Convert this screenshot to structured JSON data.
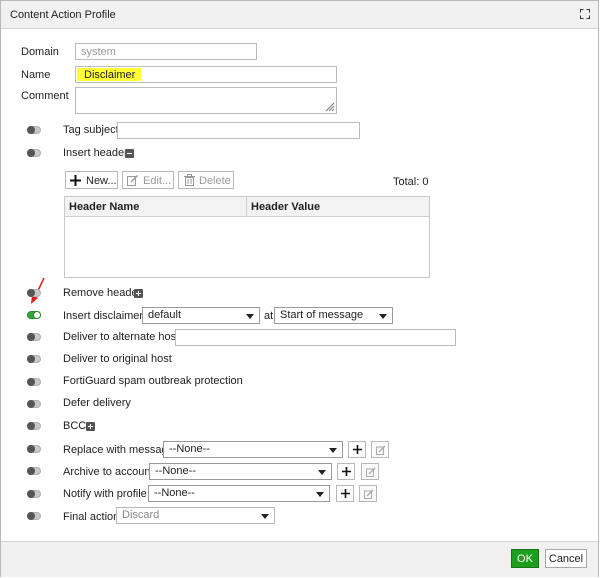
{
  "dialog": {
    "title": "Content Action Profile",
    "maximize_icon": "maximize-icon"
  },
  "form": {
    "domain_label": "Domain",
    "domain_value": "system",
    "name_label": "Name",
    "name_value": "Disclaimer",
    "comment_label": "Comment",
    "comment_value": ""
  },
  "options": {
    "tag_subject": {
      "label": "Tag subject",
      "enabled": false,
      "value": ""
    },
    "insert_header": {
      "label": "Insert header",
      "enabled": false,
      "icon": "collapse-icon"
    },
    "remove_header": {
      "label": "Remove header",
      "enabled": false,
      "icon": "expand-icon"
    },
    "insert_disclaimer": {
      "label": "Insert disclaimer",
      "enabled": true,
      "select_value": "default",
      "at_label": "at",
      "position_value": "Start of message"
    },
    "deliver_alternate_host": {
      "label": "Deliver to alternate host",
      "enabled": false,
      "value": ""
    },
    "deliver_original_host": {
      "label": "Deliver to original host",
      "enabled": false
    },
    "fortiguard_outbreak": {
      "label": "FortiGuard spam outbreak protection",
      "enabled": false
    },
    "defer_delivery": {
      "label": "Defer delivery",
      "enabled": false
    },
    "bcc": {
      "label": "BCC",
      "enabled": false,
      "icon": "expand-icon"
    },
    "replace_with_message": {
      "label": "Replace with message",
      "enabled": false,
      "select_value": "--None--"
    },
    "archive_to_account": {
      "label": "Archive to account",
      "enabled": false,
      "select_value": "--None--"
    },
    "notify_with_profile": {
      "label": "Notify with profile",
      "enabled": false,
      "select_value": "--None--"
    },
    "final_action": {
      "label": "Final action",
      "enabled": false,
      "select_value": "Discard"
    }
  },
  "header_toolbar": {
    "new_label": "New...",
    "edit_label": "Edit...",
    "delete_label": "Delete",
    "total_text": "Total: 0"
  },
  "header_table": {
    "columns": [
      "Header Name",
      "Header Value"
    ],
    "rows": []
  },
  "footer": {
    "ok_label": "OK",
    "cancel_label": "Cancel"
  },
  "colors": {
    "toggle_on": "#3aa33a",
    "ok_button": "#1e9e1e",
    "name_highlight": "#ffff33",
    "annotation_arrow": "#e02020"
  }
}
